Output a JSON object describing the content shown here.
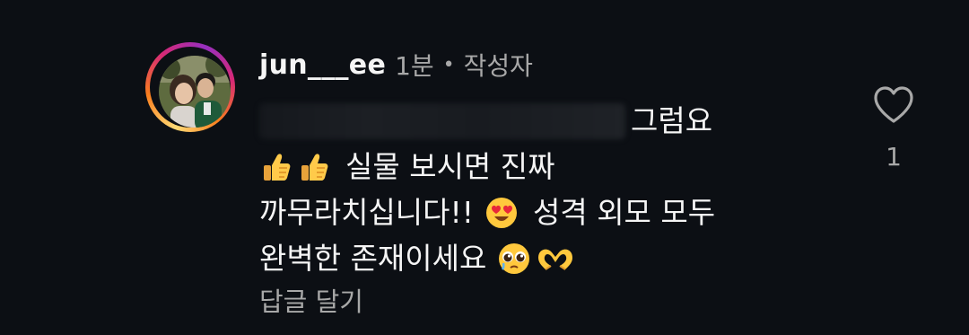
{
  "comment": {
    "username": "jun___ee",
    "time": "1분",
    "separator": "•",
    "author_badge": "작성자",
    "lines": [
      "그럼요",
      "실물 보시면 진짜",
      "까무라치십니다!!",
      "성격 외모 모두",
      "완벽한 존재이세요"
    ],
    "emojis": [
      "thumbs-up-icon",
      "thumbs-up-icon",
      "heart-eyes-icon",
      "pleading-face-icon",
      "heart-hands-icon"
    ],
    "reply_label": "답글 달기",
    "like_count": "1"
  },
  "colors": {
    "background": "#0c0f14",
    "primary_text": "#f5f5f5",
    "secondary_text": "#a8a8a8"
  }
}
